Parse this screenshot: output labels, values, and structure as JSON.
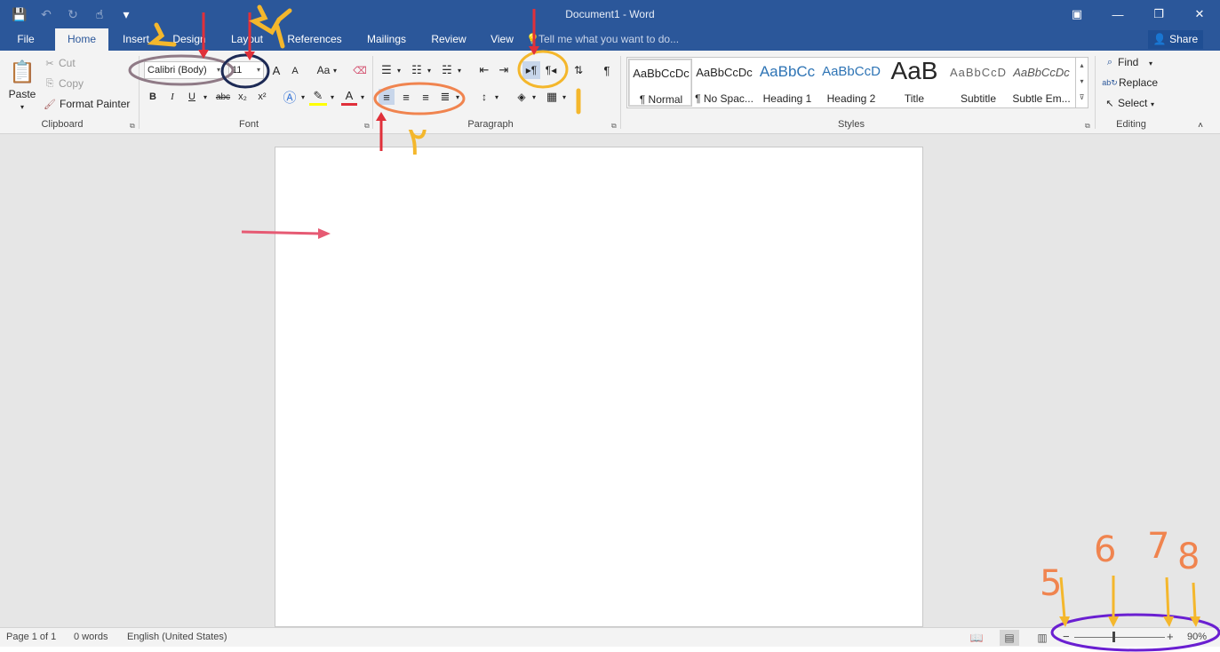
{
  "titlebar": {
    "doc_title": "Document1 - Word",
    "qat": {
      "save": "💾",
      "undo": "↶",
      "redo": "↻",
      "touch": "☝",
      "customize": "▾"
    },
    "window": {
      "ribbon_options": "▣",
      "minimize": "—",
      "restore": "❐",
      "close": "✕"
    }
  },
  "tabs": [
    {
      "label": "File",
      "active": false
    },
    {
      "label": "Home",
      "active": true
    },
    {
      "label": "Insert",
      "active": false
    },
    {
      "label": "Design",
      "active": false
    },
    {
      "label": "Layout",
      "active": false
    },
    {
      "label": "References",
      "active": false
    },
    {
      "label": "Mailings",
      "active": false
    },
    {
      "label": "Review",
      "active": false
    },
    {
      "label": "View",
      "active": false
    }
  ],
  "tell_me": "Tell me what you want to do...",
  "share": "Share",
  "clipboard": {
    "label": "Clipboard",
    "paste": "Paste",
    "cut": "Cut",
    "copy": "Copy",
    "format_painter": "Format Painter"
  },
  "font": {
    "label": "Font",
    "family": "Calibri (Body)",
    "size": "11",
    "grow": "A",
    "shrink": "A",
    "change_case": "Aa",
    "bold": "B",
    "italic": "I",
    "underline": "U",
    "strike": "abc",
    "subscript": "x₂",
    "superscript": "x²",
    "font_color": "A"
  },
  "paragraph": {
    "label": "Paragraph",
    "pilcrow": "¶"
  },
  "styles": {
    "label": "Styles",
    "items": [
      {
        "sample": "AaBbCcDc",
        "name": "¶ Normal"
      },
      {
        "sample": "AaBbCcDc",
        "name": "¶ No Spac..."
      },
      {
        "sample": "AaBbCc",
        "name": "Heading 1"
      },
      {
        "sample": "AaBbCcD",
        "name": "Heading 2"
      },
      {
        "sample": "AaB",
        "name": "Title"
      },
      {
        "sample": "AaBbCcD",
        "name": "Subtitle"
      },
      {
        "sample": "AaBbCcDc",
        "name": "Subtle Em..."
      }
    ]
  },
  "editing": {
    "label": "Editing",
    "find": "Find",
    "replace": "Replace",
    "select": "Select"
  },
  "status": {
    "page": "Page 1 of 1",
    "words": "0 words",
    "language": "English (United States)",
    "zoom": "90%",
    "zoom_out": "−",
    "zoom_in": "+"
  },
  "annotations": {
    "n5": "5",
    "n6": "6",
    "n7": "7",
    "n8": "8",
    "arabic2": "٢"
  },
  "colors": {
    "accent": "#2b579a",
    "annotation_red": "#e0303a",
    "annotation_yellow": "#f4b72c",
    "annotation_orange": "#f0844f",
    "annotation_purple": "#6a1fd1",
    "annotation_navy": "#1d2a55",
    "annotation_mauve": "#8f7a86"
  }
}
